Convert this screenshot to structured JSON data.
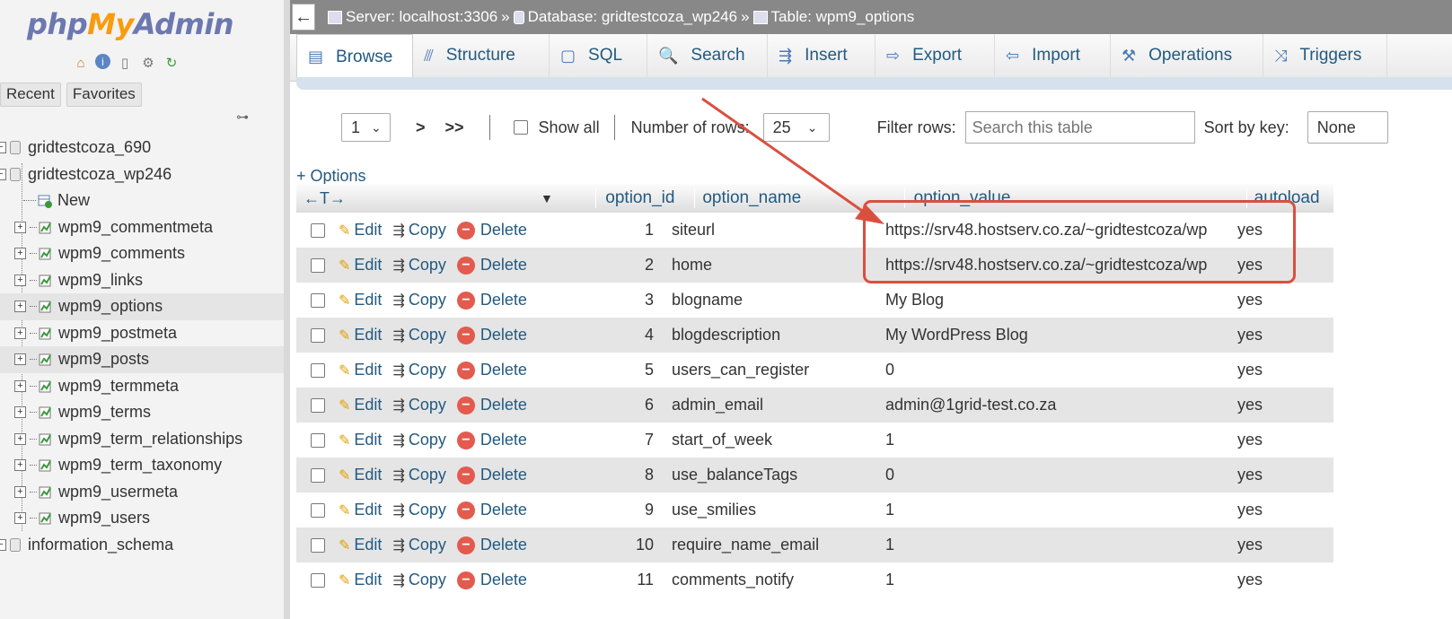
{
  "app": {
    "logo_php": "php",
    "logo_my": "My",
    "logo_admin": "Admin"
  },
  "sidebar": {
    "quick_icons": [
      "home-icon",
      "info-icon",
      "docs-icon",
      "settings-icon",
      "reload-icon"
    ],
    "tabs": [
      "Recent",
      "Favorites"
    ],
    "tree": [
      {
        "label": "gridtestcoza_690",
        "kind": "db"
      },
      {
        "label": "gridtestcoza_wp246",
        "kind": "db"
      },
      {
        "label": "New",
        "kind": "new"
      },
      {
        "label": "wpm9_commentmeta",
        "kind": "table"
      },
      {
        "label": "wpm9_comments",
        "kind": "table"
      },
      {
        "label": "wpm9_links",
        "kind": "table"
      },
      {
        "label": "wpm9_options",
        "kind": "table",
        "selected": true
      },
      {
        "label": "wpm9_postmeta",
        "kind": "table"
      },
      {
        "label": "wpm9_posts",
        "kind": "table",
        "hover": true
      },
      {
        "label": "wpm9_termmeta",
        "kind": "table"
      },
      {
        "label": "wpm9_terms",
        "kind": "table"
      },
      {
        "label": "wpm9_term_relationships",
        "kind": "table"
      },
      {
        "label": "wpm9_term_taxonomy",
        "kind": "table"
      },
      {
        "label": "wpm9_usermeta",
        "kind": "table"
      },
      {
        "label": "wpm9_users",
        "kind": "table"
      },
      {
        "label": "information_schema",
        "kind": "db"
      }
    ]
  },
  "breadcrumb": {
    "server": "Server: localhost:3306",
    "database": "Database: gridtestcoza_wp246",
    "table": "Table: wpm9_options",
    "separator": "»"
  },
  "menu": {
    "tabs": [
      {
        "label": "Browse",
        "icon": "browse-icon",
        "glyph": "▤"
      },
      {
        "label": "Structure",
        "icon": "structure-icon",
        "glyph": "⫻"
      },
      {
        "label": "SQL",
        "icon": "sql-icon",
        "glyph": "▢"
      },
      {
        "label": "Search",
        "icon": "search-icon",
        "glyph": "🔍"
      },
      {
        "label": "Insert",
        "icon": "insert-icon",
        "glyph": "⇶"
      },
      {
        "label": "Export",
        "icon": "export-icon",
        "glyph": "⇨"
      },
      {
        "label": "Import",
        "icon": "import-icon",
        "glyph": "⇦"
      },
      {
        "label": "Operations",
        "icon": "wrench-icon",
        "glyph": "⚒"
      },
      {
        "label": "Triggers",
        "icon": "triggers-icon",
        "glyph": "⤨"
      }
    ]
  },
  "nav": {
    "page_value": "1",
    "next": ">",
    "last": ">>",
    "show_all": "Show all",
    "rows_label": "Number of rows:",
    "rows_value": "25",
    "filter_label": "Filter rows:",
    "filter_placeholder": "Search this table",
    "sort_label": "Sort by key:",
    "sort_value": "None"
  },
  "options_link": "+ Options",
  "grid": {
    "arrows": "←T→",
    "columns": [
      "option_id",
      "option_name",
      "option_value",
      "autoload"
    ],
    "actions": {
      "edit": "Edit",
      "copy": "Copy",
      "delete": "Delete"
    },
    "rows": [
      {
        "id": "1",
        "name": "siteurl",
        "value": "https://srv48.hostserv.co.za/~gridtestcoza/wp",
        "autoload": "yes"
      },
      {
        "id": "2",
        "name": "home",
        "value": "https://srv48.hostserv.co.za/~gridtestcoza/wp",
        "autoload": "yes"
      },
      {
        "id": "3",
        "name": "blogname",
        "value": "My Blog",
        "autoload": "yes"
      },
      {
        "id": "4",
        "name": "blogdescription",
        "value": "My WordPress Blog",
        "autoload": "yes"
      },
      {
        "id": "5",
        "name": "users_can_register",
        "value": "0",
        "autoload": "yes"
      },
      {
        "id": "6",
        "name": "admin_email",
        "value": "admin@1grid-test.co.za",
        "autoload": "yes"
      },
      {
        "id": "7",
        "name": "start_of_week",
        "value": "1",
        "autoload": "yes"
      },
      {
        "id": "8",
        "name": "use_balanceTags",
        "value": "0",
        "autoload": "yes"
      },
      {
        "id": "9",
        "name": "use_smilies",
        "value": "1",
        "autoload": "yes"
      },
      {
        "id": "10",
        "name": "require_name_email",
        "value": "1",
        "autoload": "yes"
      },
      {
        "id": "11",
        "name": "comments_notify",
        "value": "1",
        "autoload": "yes"
      }
    ]
  },
  "colors": {
    "link": "#235a81",
    "annotation": "#d9503f",
    "topbar": "#888888"
  }
}
